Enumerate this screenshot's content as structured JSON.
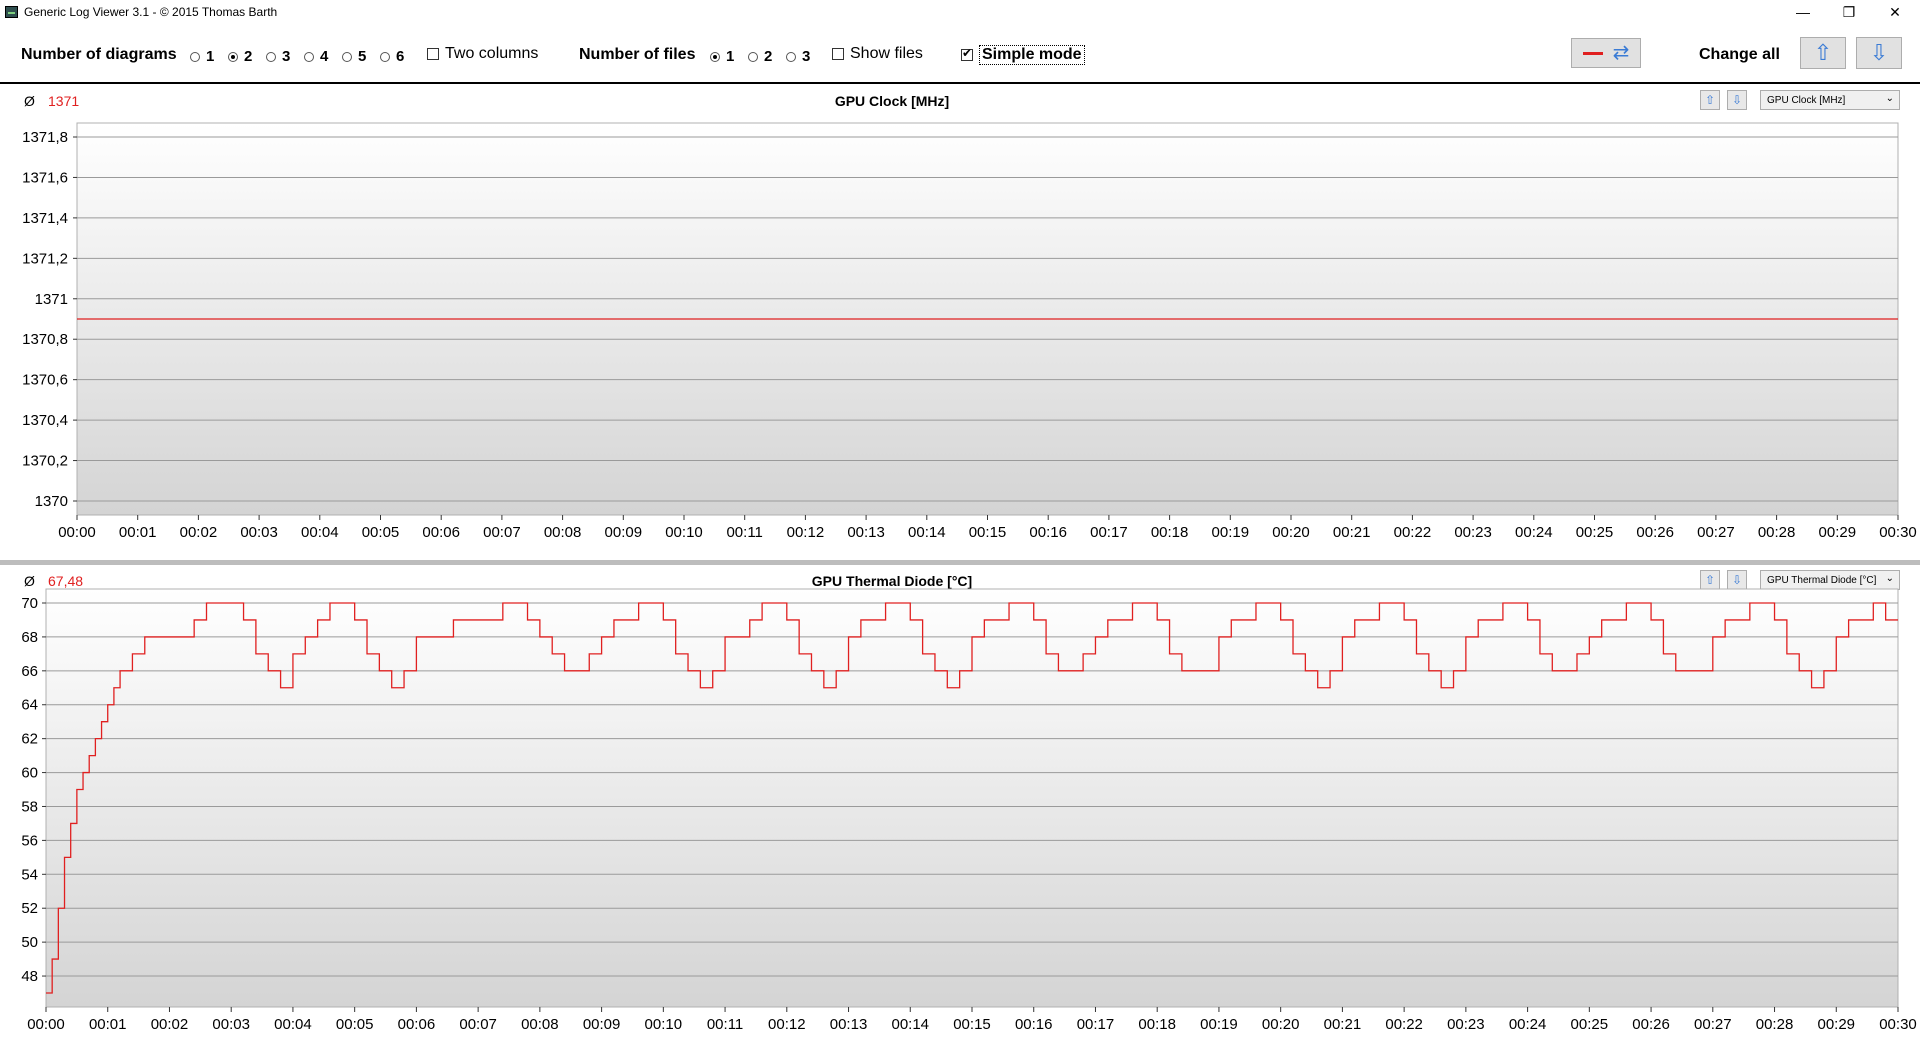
{
  "window": {
    "title": "Generic Log Viewer 3.1 - © 2015 Thomas Barth",
    "minimize_icon": "minimize-icon",
    "restore_icon": "restore-icon",
    "close_icon": "close-icon"
  },
  "toolbar": {
    "num_diagrams_label": "Number of diagrams",
    "diagram_options": [
      "1",
      "2",
      "3",
      "4",
      "5",
      "6"
    ],
    "diagram_selected": "2",
    "two_columns_label": "Two columns",
    "two_columns_checked": false,
    "num_files_label": "Number of files",
    "file_options": [
      "1",
      "2",
      "3"
    ],
    "file_selected": "1",
    "show_files_label": "Show files",
    "show_files_checked": false,
    "simple_mode_label": "Simple mode",
    "simple_mode_checked": true,
    "change_all_label": "Change all",
    "line_color": "#e02020",
    "accent_color": "#3a7bd5"
  },
  "diagrams": [
    {
      "avg_symbol": "Ø",
      "avg_value": "1371",
      "title": "GPU Clock [MHz]",
      "selector_value": "GPU Clock [MHz]"
    },
    {
      "avg_symbol": "Ø",
      "avg_value": "67,48",
      "title": "GPU Thermal Diode [°C]",
      "selector_value": "GPU Thermal Diode [°C]"
    }
  ],
  "chart_data": [
    {
      "type": "line",
      "title": "GPU Clock [MHz]",
      "y_ticks": [
        "1371,8",
        "1371,6",
        "1371,4",
        "1371,2",
        "1371",
        "1370,8",
        "1370,6",
        "1370,4",
        "1370,2",
        "1370"
      ],
      "ylim": [
        1370,
        1371.8
      ],
      "x_ticks": [
        "00:00",
        "00:01",
        "00:02",
        "00:03",
        "00:04",
        "00:05",
        "00:06",
        "00:07",
        "00:08",
        "00:09",
        "00:10",
        "00:11",
        "00:12",
        "00:13",
        "00:14",
        "00:15",
        "00:16",
        "00:17",
        "00:18",
        "00:19",
        "00:20",
        "00:21",
        "00:22",
        "00:23",
        "00:24",
        "00:25",
        "00:26",
        "00:27",
        "00:28",
        "00:29",
        "00:30"
      ],
      "xlim_minutes": [
        0,
        30
      ],
      "series": [
        {
          "x": [
            0,
            30
          ],
          "y": [
            1370.9,
            1370.9
          ]
        }
      ]
    },
    {
      "type": "line",
      "title": "GPU Thermal Diode [°C]",
      "y_ticks": [
        "70",
        "68",
        "66",
        "64",
        "62",
        "60",
        "58",
        "56",
        "54",
        "52",
        "50",
        "48"
      ],
      "ylim": [
        47,
        70
      ],
      "x_ticks": [
        "00:00",
        "00:01",
        "00:02",
        "00:03",
        "00:04",
        "00:05",
        "00:06",
        "00:07",
        "00:08",
        "00:09",
        "00:10",
        "00:11",
        "00:12",
        "00:13",
        "00:14",
        "00:15",
        "00:16",
        "00:17",
        "00:18",
        "00:19",
        "00:20",
        "00:21",
        "00:22",
        "00:23",
        "00:24",
        "00:25",
        "00:26",
        "00:27",
        "00:28",
        "00:29",
        "00:30"
      ],
      "xlim_minutes": [
        0,
        30
      ],
      "series": [
        {
          "x": [
            0,
            0.1,
            0.2,
            0.3,
            0.4,
            0.5,
            0.6,
            0.7,
            0.8,
            0.9,
            1.0,
            1.1,
            1.2,
            1.3,
            1.4,
            1.5,
            1.6,
            1.7,
            1.8,
            1.9,
            2.0,
            2.2,
            2.4,
            2.6,
            2.8,
            3.0,
            3.2,
            3.4,
            3.6,
            3.8,
            4.0,
            4.2,
            4.4,
            4.6,
            4.8,
            5.0,
            5.2,
            5.4,
            5.6,
            5.8,
            6.0,
            6.2,
            6.4,
            6.6,
            6.8,
            7.0,
            7.2,
            7.4,
            7.6,
            7.8,
            8.0,
            8.2,
            8.4,
            8.6,
            8.8,
            9.0,
            9.2,
            9.4,
            9.6,
            9.8,
            10.0,
            10.2,
            10.4,
            10.6,
            10.8,
            11.0,
            11.2,
            11.4,
            11.6,
            11.8,
            12.0,
            12.2,
            12.4,
            12.6,
            12.8,
            13.0,
            13.2,
            13.4,
            13.6,
            13.8,
            14.0,
            14.2,
            14.4,
            14.6,
            14.8,
            15.0,
            15.2,
            15.4,
            15.6,
            15.8,
            16.0,
            16.2,
            16.4,
            16.6,
            16.8,
            17.0,
            17.2,
            17.4,
            17.6,
            17.8,
            18.0,
            18.2,
            18.4,
            18.6,
            18.8,
            19.0,
            19.2,
            19.4,
            19.6,
            19.8,
            20.0,
            20.2,
            20.4,
            20.6,
            20.8,
            21.0,
            21.2,
            21.4,
            21.6,
            21.8,
            22.0,
            22.2,
            22.4,
            22.6,
            22.8,
            23.0,
            23.2,
            23.4,
            23.6,
            23.8,
            24.0,
            24.2,
            24.4,
            24.6,
            24.8,
            25.0,
            25.2,
            25.4,
            25.6,
            25.8,
            26.0,
            26.2,
            26.4,
            26.6,
            26.8,
            27.0,
            27.2,
            27.4,
            27.6,
            27.8,
            28.0,
            28.2,
            28.4,
            28.6,
            28.8,
            29.0,
            29.2,
            29.4,
            29.6,
            29.8,
            30.0
          ],
          "y": [
            47,
            49,
            52,
            55,
            57,
            59,
            60,
            61,
            62,
            63,
            64,
            65,
            66,
            66,
            67,
            67,
            68,
            68,
            68,
            68,
            68,
            68,
            69,
            70,
            70,
            70,
            69,
            67,
            66,
            65,
            67,
            68,
            69,
            70,
            70,
            69,
            67,
            66,
            65,
            66,
            68,
            68,
            68,
            69,
            69,
            69,
            69,
            70,
            70,
            69,
            68,
            67,
            66,
            66,
            67,
            68,
            69,
            69,
            70,
            70,
            69,
            67,
            66,
            65,
            66,
            68,
            68,
            69,
            70,
            70,
            69,
            67,
            66,
            65,
            66,
            68,
            69,
            69,
            70,
            70,
            69,
            67,
            66,
            65,
            66,
            68,
            69,
            69,
            70,
            70,
            69,
            67,
            66,
            66,
            67,
            68,
            69,
            69,
            70,
            70,
            69,
            67,
            66,
            66,
            66,
            68,
            69,
            69,
            70,
            70,
            69,
            67,
            66,
            65,
            66,
            68,
            69,
            69,
            70,
            70,
            69,
            67,
            66,
            65,
            66,
            68,
            69,
            69,
            70,
            70,
            69,
            67,
            66,
            66,
            67,
            68,
            69,
            69,
            70,
            70,
            69,
            67,
            66,
            66,
            66,
            68,
            69,
            69,
            70,
            70,
            69,
            67,
            66,
            65,
            66,
            68,
            69,
            69,
            70,
            69,
            69
          ]
        }
      ]
    }
  ]
}
